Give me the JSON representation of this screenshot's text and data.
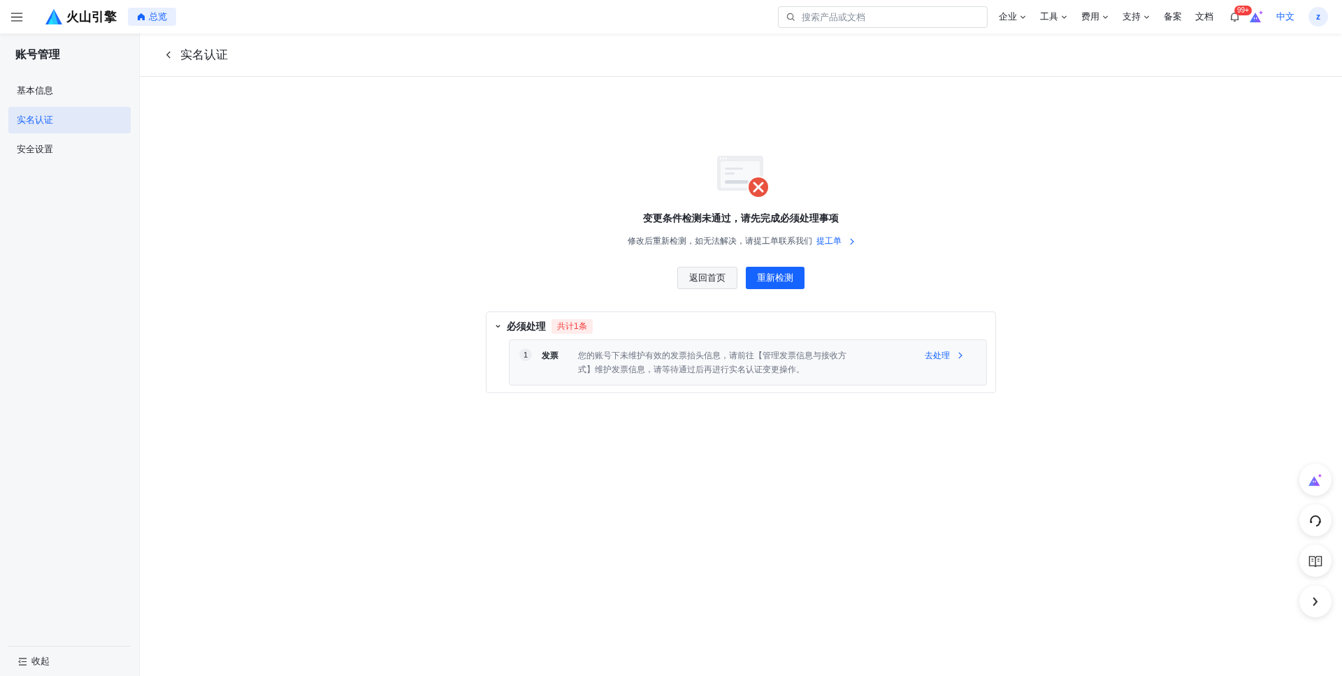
{
  "header": {
    "logo_text": "火山引擎",
    "home_chip": "总览",
    "search": {
      "placeholder": "搜索产品或文档"
    },
    "nav": [
      {
        "label": "企业",
        "dropdown": true
      },
      {
        "label": "工具",
        "dropdown": true
      },
      {
        "label": "费用",
        "dropdown": true
      },
      {
        "label": "支持",
        "dropdown": true
      },
      {
        "label": "备案",
        "dropdown": false
      },
      {
        "label": "文档",
        "dropdown": false
      }
    ],
    "notification_badge": "99+",
    "language": {
      "label": "中文",
      "selected": true
    },
    "avatar": "z"
  },
  "sidebar": {
    "title": "账号管理",
    "items": [
      {
        "label": "基本信息",
        "selected": false
      },
      {
        "label": "实名认证",
        "selected": true
      },
      {
        "label": "安全设置",
        "selected": false
      }
    ],
    "collapse": "收起"
  },
  "page": {
    "title": "实名认证"
  },
  "result": {
    "heading": "变更条件检测未通过，请先完成必须处理事项",
    "description": "修改后重新检测，如无法解决，请提工单联系我们",
    "link": "提工单",
    "buttons": [
      {
        "label": "返回首页",
        "kind": "secondary"
      },
      {
        "label": "重新检测",
        "kind": "primary"
      }
    ]
  },
  "section": {
    "title": "必须处理",
    "count": "共计1条",
    "expanded": true,
    "items": [
      {
        "index": "1",
        "name": "发票",
        "description": "您的账号下未维护有效的发票抬头信息，请前往【管理发票信息与接收方式】维护发票信息，请等待通过后再进行实名认证变更操作。",
        "action": "去处理"
      }
    ]
  }
}
